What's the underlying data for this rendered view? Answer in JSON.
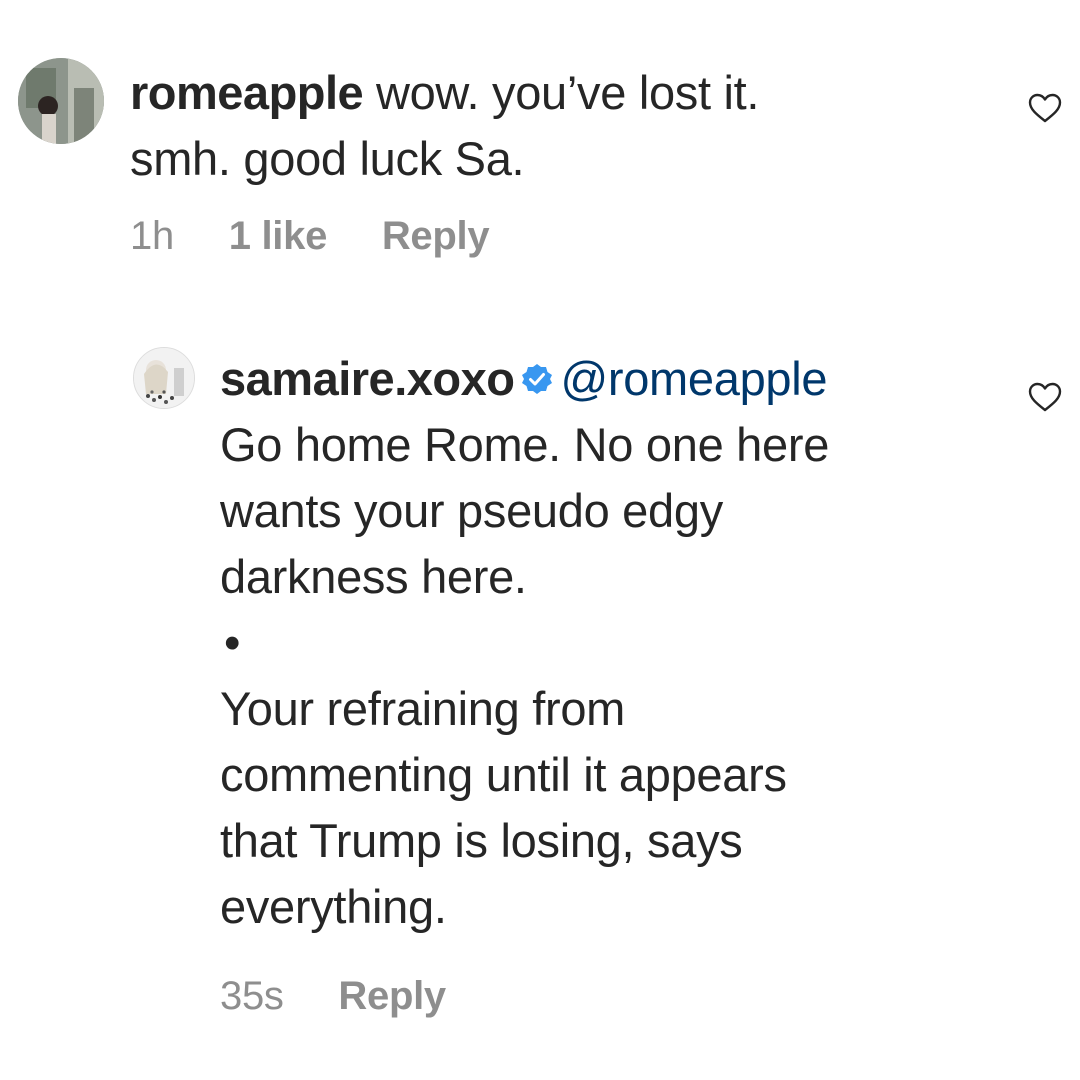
{
  "comments": [
    {
      "username": "romeapple",
      "verified": false,
      "lines": [
        "wow. you’ve lost it.",
        "smh. good luck Sa."
      ],
      "time": "1h",
      "likes": "1 like",
      "reply_label": "Reply",
      "avatar_icon": "profile-photo",
      "like_icon": "heart-outline-icon"
    },
    {
      "username": "samaire.xoxo",
      "verified": true,
      "mention": "@romeapple",
      "lines": [
        "Go home Rome. No one here",
        "wants your pseudo edgy",
        "darkness here.",
        "•",
        "Your refraining from",
        "commenting until it appears",
        "that Trump is losing, says",
        "everything."
      ],
      "time": "35s",
      "reply_label": "Reply",
      "avatar_icon": "profile-photo",
      "like_icon": "heart-outline-icon"
    }
  ],
  "colors": {
    "text": "#262626",
    "secondary": "#8e8e8e",
    "mention": "#00376b",
    "verified": "#3897f0"
  }
}
